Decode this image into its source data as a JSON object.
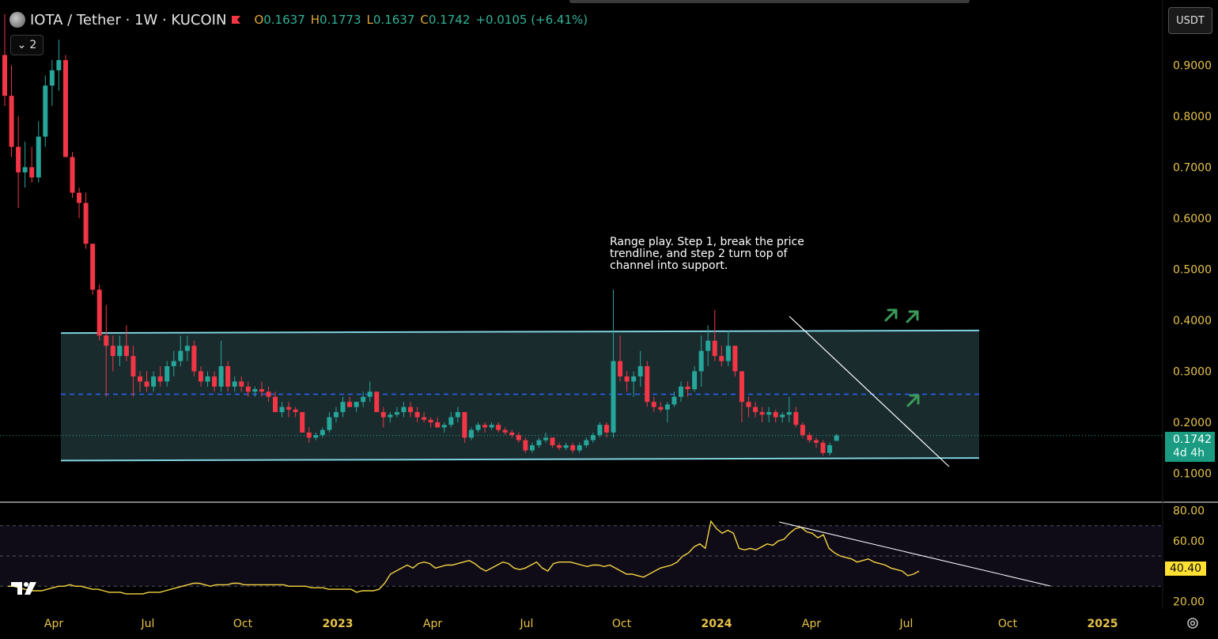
{
  "header": {
    "symbol": "IOTA / Tether · 1W · KUCOIN",
    "open_label": "O",
    "open": "0.1637",
    "high_label": "H",
    "high": "0.1773",
    "low_label": "L",
    "low": "0.1637",
    "close_label": "C",
    "close": "0.1742",
    "change": "+0.0105 (+6.41%)",
    "indicator_count": "2"
  },
  "currency_button": "USDT",
  "annotation": "Range play. Step 1, break the price trendline, and step 2 turn top of channel into support.",
  "last_price": {
    "price": "0.1742",
    "countdown": "4d 4h"
  },
  "rsi_last": "40.40",
  "colors": {
    "up": "#26a69a",
    "down": "#f23645",
    "channel": "#7fd3e0",
    "channel_fill": "#1f3236",
    "mid_line": "#2962ff",
    "rsi_line": "#f5d442",
    "arrow": "#3c9a5a",
    "trendline": "#ffffff"
  },
  "chart_data": [
    {
      "type": "candlestick",
      "title": "IOTA / Tether · 1W · KUCOIN",
      "x_ticks": [
        "Apr",
        "Jul",
        "Oct",
        "2023",
        "Apr",
        "Jul",
        "Oct",
        "2024",
        "Apr",
        "Jul",
        "Oct",
        "2025"
      ],
      "y_ticks": [
        "0.9000",
        "0.8000",
        "0.7000",
        "0.6000",
        "0.5000",
        "0.4000",
        "0.3000",
        "0.2000",
        "0.1000"
      ],
      "ylim": [
        0.045,
        1.02
      ],
      "candles": [
        [
          0.92,
          1.0,
          0.82,
          0.84
        ],
        [
          0.84,
          0.9,
          0.72,
          0.74
        ],
        [
          0.74,
          0.8,
          0.62,
          0.69
        ],
        [
          0.69,
          0.75,
          0.66,
          0.7
        ],
        [
          0.7,
          0.74,
          0.67,
          0.68
        ],
        [
          0.68,
          0.79,
          0.67,
          0.76
        ],
        [
          0.76,
          0.88,
          0.74,
          0.86
        ],
        [
          0.86,
          0.91,
          0.82,
          0.89
        ],
        [
          0.89,
          0.95,
          0.85,
          0.91
        ],
        [
          0.91,
          0.92,
          0.72,
          0.72
        ],
        [
          0.72,
          0.73,
          0.64,
          0.65
        ],
        [
          0.65,
          0.66,
          0.6,
          0.63
        ],
        [
          0.63,
          0.65,
          0.54,
          0.55
        ],
        [
          0.55,
          0.55,
          0.45,
          0.46
        ],
        [
          0.46,
          0.47,
          0.36,
          0.37
        ],
        [
          0.37,
          0.43,
          0.25,
          0.35
        ],
        [
          0.35,
          0.37,
          0.3,
          0.33
        ],
        [
          0.33,
          0.37,
          0.31,
          0.35
        ],
        [
          0.35,
          0.39,
          0.32,
          0.33
        ],
        [
          0.33,
          0.35,
          0.25,
          0.29
        ],
        [
          0.29,
          0.3,
          0.26,
          0.28
        ],
        [
          0.28,
          0.3,
          0.26,
          0.27
        ],
        [
          0.27,
          0.3,
          0.26,
          0.29
        ],
        [
          0.29,
          0.31,
          0.27,
          0.28
        ],
        [
          0.28,
          0.32,
          0.27,
          0.31
        ],
        [
          0.31,
          0.34,
          0.29,
          0.32
        ],
        [
          0.32,
          0.37,
          0.31,
          0.34
        ],
        [
          0.34,
          0.37,
          0.32,
          0.35
        ],
        [
          0.35,
          0.36,
          0.29,
          0.3
        ],
        [
          0.3,
          0.31,
          0.27,
          0.28
        ],
        [
          0.28,
          0.3,
          0.27,
          0.29
        ],
        [
          0.29,
          0.3,
          0.26,
          0.27
        ],
        [
          0.27,
          0.36,
          0.26,
          0.31
        ],
        [
          0.31,
          0.32,
          0.26,
          0.27
        ],
        [
          0.27,
          0.29,
          0.26,
          0.28
        ],
        [
          0.28,
          0.29,
          0.26,
          0.27
        ],
        [
          0.27,
          0.28,
          0.25,
          0.26
        ],
        [
          0.26,
          0.27,
          0.25,
          0.265
        ],
        [
          0.265,
          0.28,
          0.25,
          0.26
        ],
        [
          0.26,
          0.27,
          0.24,
          0.25
        ],
        [
          0.25,
          0.26,
          0.22,
          0.22
        ],
        [
          0.22,
          0.24,
          0.21,
          0.23
        ],
        [
          0.23,
          0.24,
          0.21,
          0.225
        ],
        [
          0.225,
          0.23,
          0.21,
          0.22
        ],
        [
          0.22,
          0.22,
          0.18,
          0.18
        ],
        [
          0.18,
          0.19,
          0.16,
          0.17
        ],
        [
          0.17,
          0.18,
          0.165,
          0.175
        ],
        [
          0.175,
          0.19,
          0.17,
          0.185
        ],
        [
          0.185,
          0.22,
          0.18,
          0.21
        ],
        [
          0.21,
          0.23,
          0.2,
          0.22
        ],
        [
          0.22,
          0.25,
          0.21,
          0.24
        ],
        [
          0.24,
          0.25,
          0.23,
          0.23
        ],
        [
          0.23,
          0.24,
          0.22,
          0.24
        ],
        [
          0.24,
          0.26,
          0.23,
          0.25
        ],
        [
          0.25,
          0.28,
          0.24,
          0.26
        ],
        [
          0.26,
          0.26,
          0.22,
          0.22
        ],
        [
          0.22,
          0.23,
          0.19,
          0.21
        ],
        [
          0.21,
          0.22,
          0.2,
          0.215
        ],
        [
          0.215,
          0.23,
          0.21,
          0.22
        ],
        [
          0.22,
          0.24,
          0.21,
          0.23
        ],
        [
          0.23,
          0.24,
          0.21,
          0.22
        ],
        [
          0.22,
          0.23,
          0.2,
          0.21
        ],
        [
          0.21,
          0.22,
          0.2,
          0.205
        ],
        [
          0.205,
          0.21,
          0.19,
          0.2
        ],
        [
          0.2,
          0.21,
          0.19,
          0.19
        ],
        [
          0.19,
          0.2,
          0.18,
          0.195
        ],
        [
          0.195,
          0.22,
          0.19,
          0.21
        ],
        [
          0.21,
          0.23,
          0.2,
          0.22
        ],
        [
          0.22,
          0.22,
          0.16,
          0.17
        ],
        [
          0.17,
          0.19,
          0.165,
          0.185
        ],
        [
          0.185,
          0.2,
          0.18,
          0.195
        ],
        [
          0.195,
          0.2,
          0.18,
          0.19
        ],
        [
          0.19,
          0.2,
          0.185,
          0.195
        ],
        [
          0.195,
          0.2,
          0.18,
          0.185
        ],
        [
          0.185,
          0.19,
          0.175,
          0.18
        ],
        [
          0.18,
          0.185,
          0.17,
          0.175
        ],
        [
          0.175,
          0.18,
          0.16,
          0.165
        ],
        [
          0.165,
          0.17,
          0.14,
          0.145
        ],
        [
          0.145,
          0.16,
          0.14,
          0.155
        ],
        [
          0.155,
          0.17,
          0.15,
          0.165
        ],
        [
          0.165,
          0.18,
          0.16,
          0.17
        ],
        [
          0.17,
          0.17,
          0.15,
          0.155
        ],
        [
          0.155,
          0.16,
          0.145,
          0.15
        ],
        [
          0.15,
          0.16,
          0.145,
          0.155
        ],
        [
          0.155,
          0.16,
          0.14,
          0.145
        ],
        [
          0.145,
          0.16,
          0.14,
          0.155
        ],
        [
          0.155,
          0.17,
          0.15,
          0.165
        ],
        [
          0.165,
          0.18,
          0.16,
          0.175
        ],
        [
          0.175,
          0.2,
          0.17,
          0.195
        ],
        [
          0.195,
          0.2,
          0.17,
          0.18
        ],
        [
          0.18,
          0.46,
          0.17,
          0.32
        ],
        [
          0.32,
          0.37,
          0.28,
          0.29
        ],
        [
          0.29,
          0.3,
          0.26,
          0.28
        ],
        [
          0.28,
          0.3,
          0.25,
          0.29
        ],
        [
          0.29,
          0.34,
          0.27,
          0.31
        ],
        [
          0.31,
          0.32,
          0.23,
          0.24
        ],
        [
          0.24,
          0.25,
          0.22,
          0.23
        ],
        [
          0.23,
          0.24,
          0.22,
          0.225
        ],
        [
          0.225,
          0.24,
          0.2,
          0.235
        ],
        [
          0.235,
          0.26,
          0.23,
          0.25
        ],
        [
          0.25,
          0.28,
          0.24,
          0.27
        ],
        [
          0.27,
          0.28,
          0.25,
          0.265
        ],
        [
          0.265,
          0.31,
          0.26,
          0.3
        ],
        [
          0.3,
          0.37,
          0.27,
          0.34
        ],
        [
          0.34,
          0.39,
          0.31,
          0.36
        ],
        [
          0.36,
          0.42,
          0.32,
          0.33
        ],
        [
          0.33,
          0.35,
          0.31,
          0.32
        ],
        [
          0.32,
          0.38,
          0.31,
          0.35
        ],
        [
          0.35,
          0.35,
          0.29,
          0.3
        ],
        [
          0.3,
          0.3,
          0.2,
          0.24
        ],
        [
          0.24,
          0.25,
          0.21,
          0.23
        ],
        [
          0.23,
          0.24,
          0.21,
          0.22
        ],
        [
          0.22,
          0.23,
          0.2,
          0.215
        ],
        [
          0.215,
          0.23,
          0.2,
          0.22
        ],
        [
          0.22,
          0.225,
          0.2,
          0.21
        ],
        [
          0.21,
          0.22,
          0.2,
          0.215
        ],
        [
          0.215,
          0.25,
          0.2,
          0.22
        ],
        [
          0.22,
          0.23,
          0.19,
          0.195
        ],
        [
          0.195,
          0.2,
          0.17,
          0.175
        ],
        [
          0.175,
          0.18,
          0.16,
          0.165
        ],
        [
          0.165,
          0.17,
          0.15,
          0.16
        ],
        [
          0.16,
          0.165,
          0.135,
          0.14
        ],
        [
          0.14,
          0.16,
          0.135,
          0.155
        ],
        [
          0.1637,
          0.1773,
          0.1637,
          0.1742
        ]
      ],
      "channel": {
        "top": [
          0.375,
          0.38
        ],
        "bottom": [
          0.125,
          0.13
        ],
        "middle": 0.255
      },
      "last_price": 0.1742,
      "countdown": "4d 4h"
    },
    {
      "type": "line",
      "title": "RSI",
      "y_ticks": [
        "80.00",
        "60.00",
        "40.40",
        "20.00"
      ],
      "ylim": [
        15,
        85
      ],
      "levels": [
        70,
        50,
        30
      ],
      "series": [
        {
          "values": [
            30,
            30,
            29,
            28,
            27,
            27,
            27,
            28,
            29,
            30,
            30,
            31,
            30,
            30,
            29,
            28,
            28,
            27,
            26,
            26,
            26,
            25,
            25,
            25,
            25,
            26,
            26,
            26,
            27,
            28,
            29,
            30,
            31,
            32,
            32,
            31,
            30,
            31,
            31,
            31,
            32,
            32,
            31,
            31,
            31,
            31,
            31,
            31,
            31,
            31,
            30,
            30,
            30,
            30,
            29,
            29,
            29,
            28,
            28,
            28,
            28,
            28,
            26,
            27,
            27,
            27,
            28,
            32,
            38,
            40,
            42,
            44,
            42,
            45,
            46,
            45,
            42,
            43,
            44,
            44,
            45,
            46,
            47,
            45,
            42,
            40,
            42,
            44,
            46,
            45,
            42,
            41,
            42,
            44,
            46,
            42,
            40,
            45,
            46,
            46,
            46,
            45,
            44,
            43,
            44,
            44,
            43,
            44,
            42,
            40,
            38,
            38,
            37,
            36,
            38,
            40,
            42,
            43,
            44,
            46,
            50,
            52,
            56,
            58,
            55,
            73,
            68,
            65,
            67,
            65,
            55,
            54,
            55,
            54,
            56,
            58,
            57,
            60,
            61,
            65,
            68,
            69,
            66,
            65,
            62,
            64,
            55,
            52,
            50,
            49,
            48,
            46,
            47,
            48,
            46,
            45,
            44,
            42,
            41,
            40,
            37,
            38,
            40
          ]
        }
      ],
      "last": 40.4
    }
  ]
}
